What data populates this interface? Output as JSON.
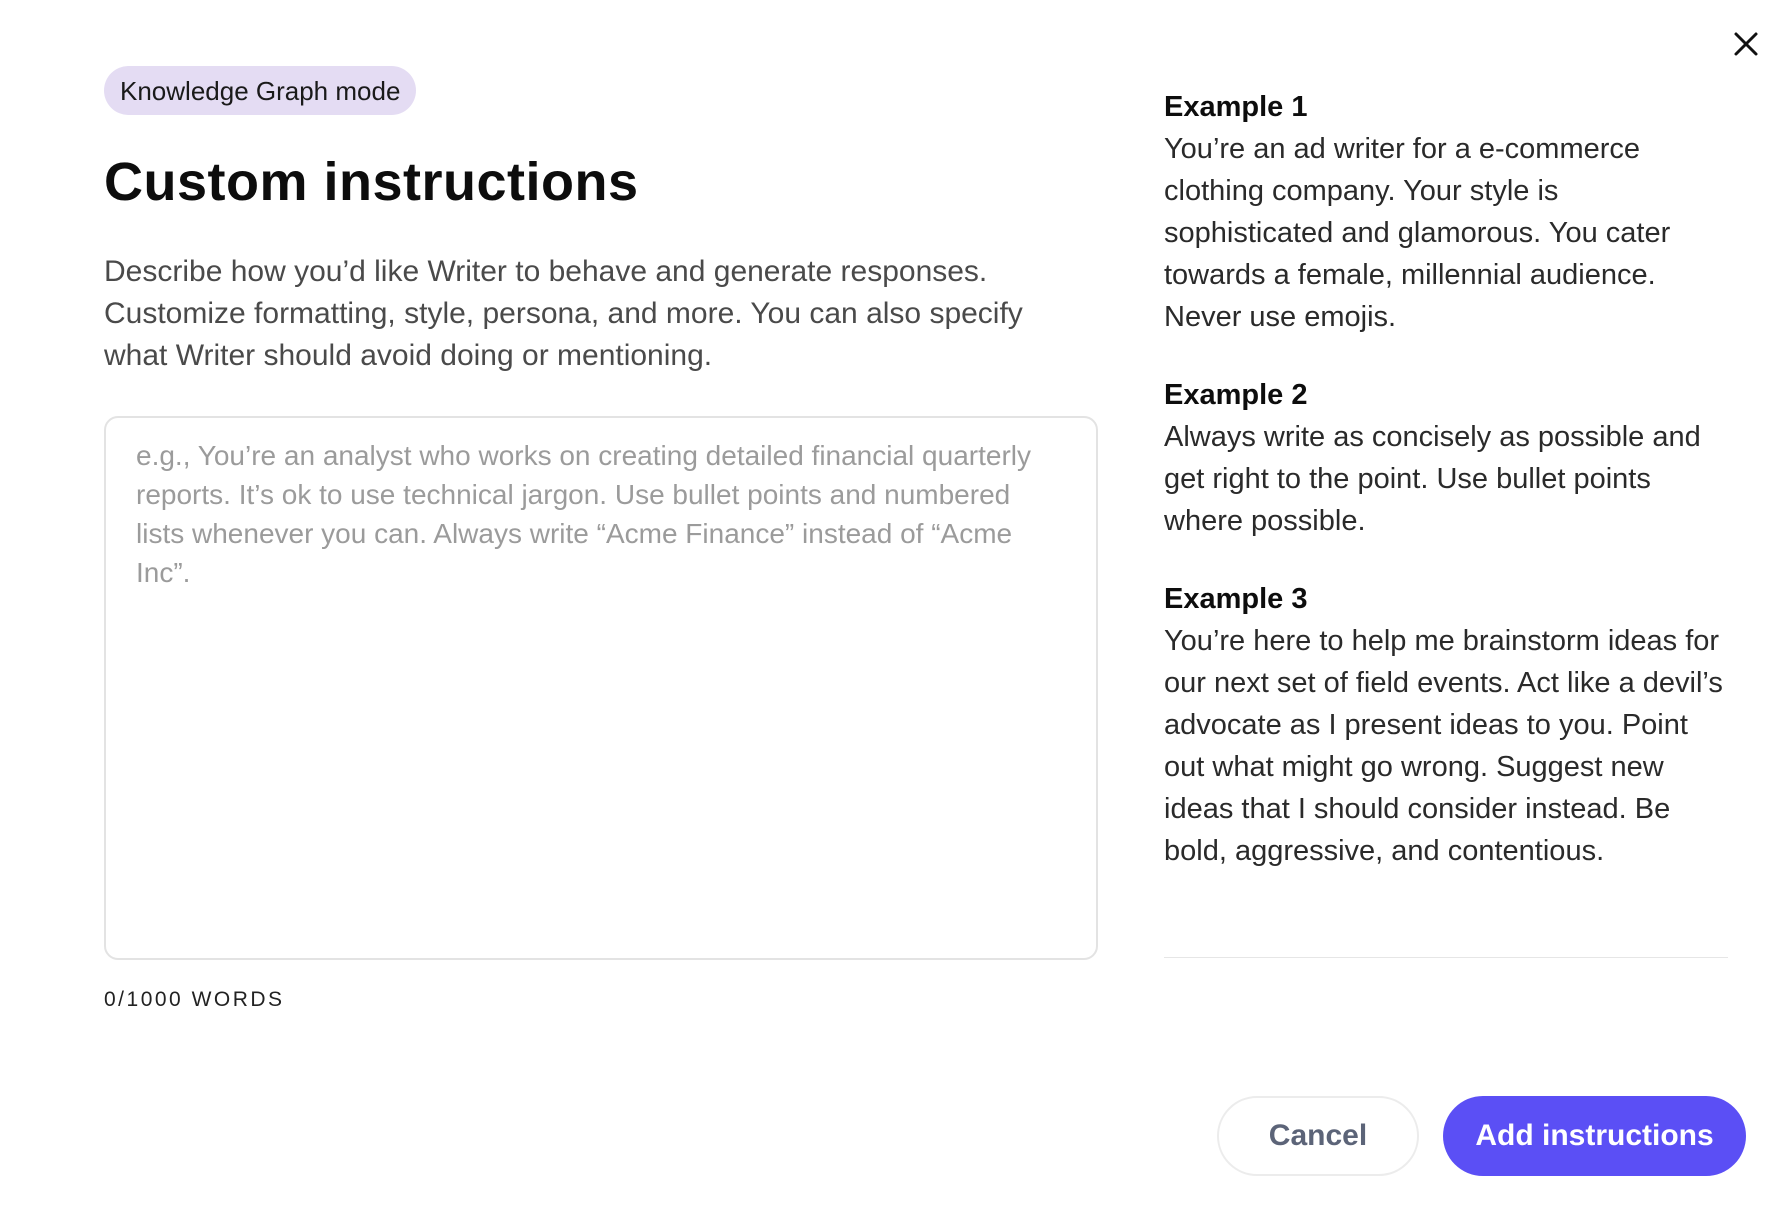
{
  "modal": {
    "close_icon": "close-icon",
    "mode_badge": "Knowledge Graph mode",
    "title": "Custom instructions",
    "description": "Describe how you’d like Writer to behave and generate responses. Customize formatting, style, persona, and more. You can also specify what Writer should avoid doing or mentioning.",
    "instructions_input": {
      "value": "",
      "placeholder": "e.g., You’re an analyst who works on creating detailed financial quarterly reports. It’s ok to use technical jargon. Use bullet points and numbered lists whenever you can. Always write “Acme Finance” instead of “Acme Inc”."
    },
    "word_count": "0/1000 WORDS"
  },
  "examples": [
    {
      "title": "Example 1",
      "body": "You’re an ad writer for a e-commerce clothing company. Your style is sophisticated and glamorous. You cater towards a female, millennial audience. Never use emojis."
    },
    {
      "title": "Example 2",
      "body": "Always write as concisely as possible and get right to the point. Use bullet points where possible."
    },
    {
      "title": "Example 3",
      "body": "You’re here to help me brainstorm ideas for our next set of field events. Act like a devil’s advocate as I present ideas to you. Point out what might go wrong. Suggest new ideas that I should consider instead. Be bold, aggressive, and contentious."
    }
  ],
  "actions": {
    "cancel_label": "Cancel",
    "add_label": "Add instructions"
  },
  "colors": {
    "accent": "#5b4ff5",
    "badge_bg": "#e4dcf3",
    "cancel_text": "#5c6478"
  }
}
